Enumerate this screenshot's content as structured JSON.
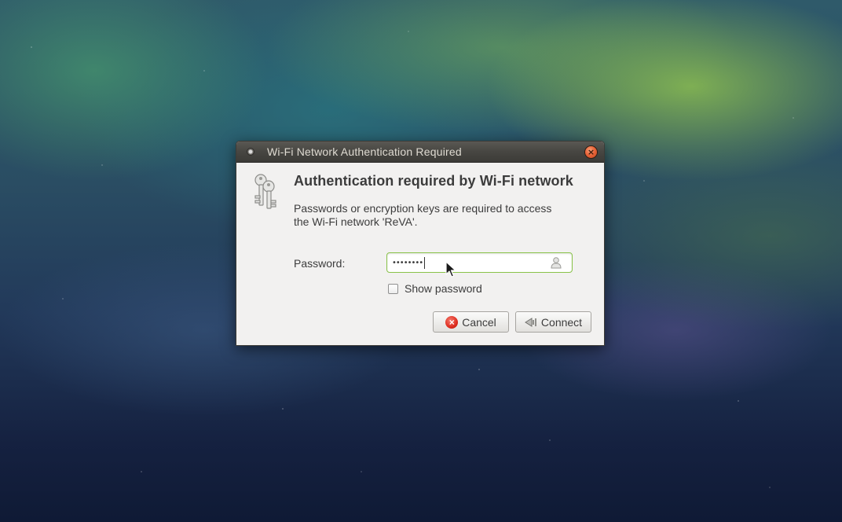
{
  "dialog": {
    "title": "Wi-Fi Network Authentication Required",
    "close_icon": "close-icon",
    "heading": "Authentication required by Wi-Fi network",
    "description_line1": "Passwords or encryption keys are required to access",
    "description_line2": "the Wi-Fi network 'ReVA'.",
    "password_label": "Password:",
    "password_value": "••••••••",
    "show_password_label": "Show password",
    "show_password_checked": false,
    "cancel_label": "Cancel",
    "connect_label": "Connect",
    "icons": {
      "header": "keys-icon",
      "password_field": "person-icon",
      "cancel": "cancel-icon",
      "connect": "network-connect-icon"
    },
    "colors": {
      "titlebar": "#3c3b37",
      "dialog_bg": "#f2f1f0",
      "focus_border": "#8ac34a",
      "close_button": "#e9653a",
      "cancel_icon": "#de2d1f"
    }
  }
}
